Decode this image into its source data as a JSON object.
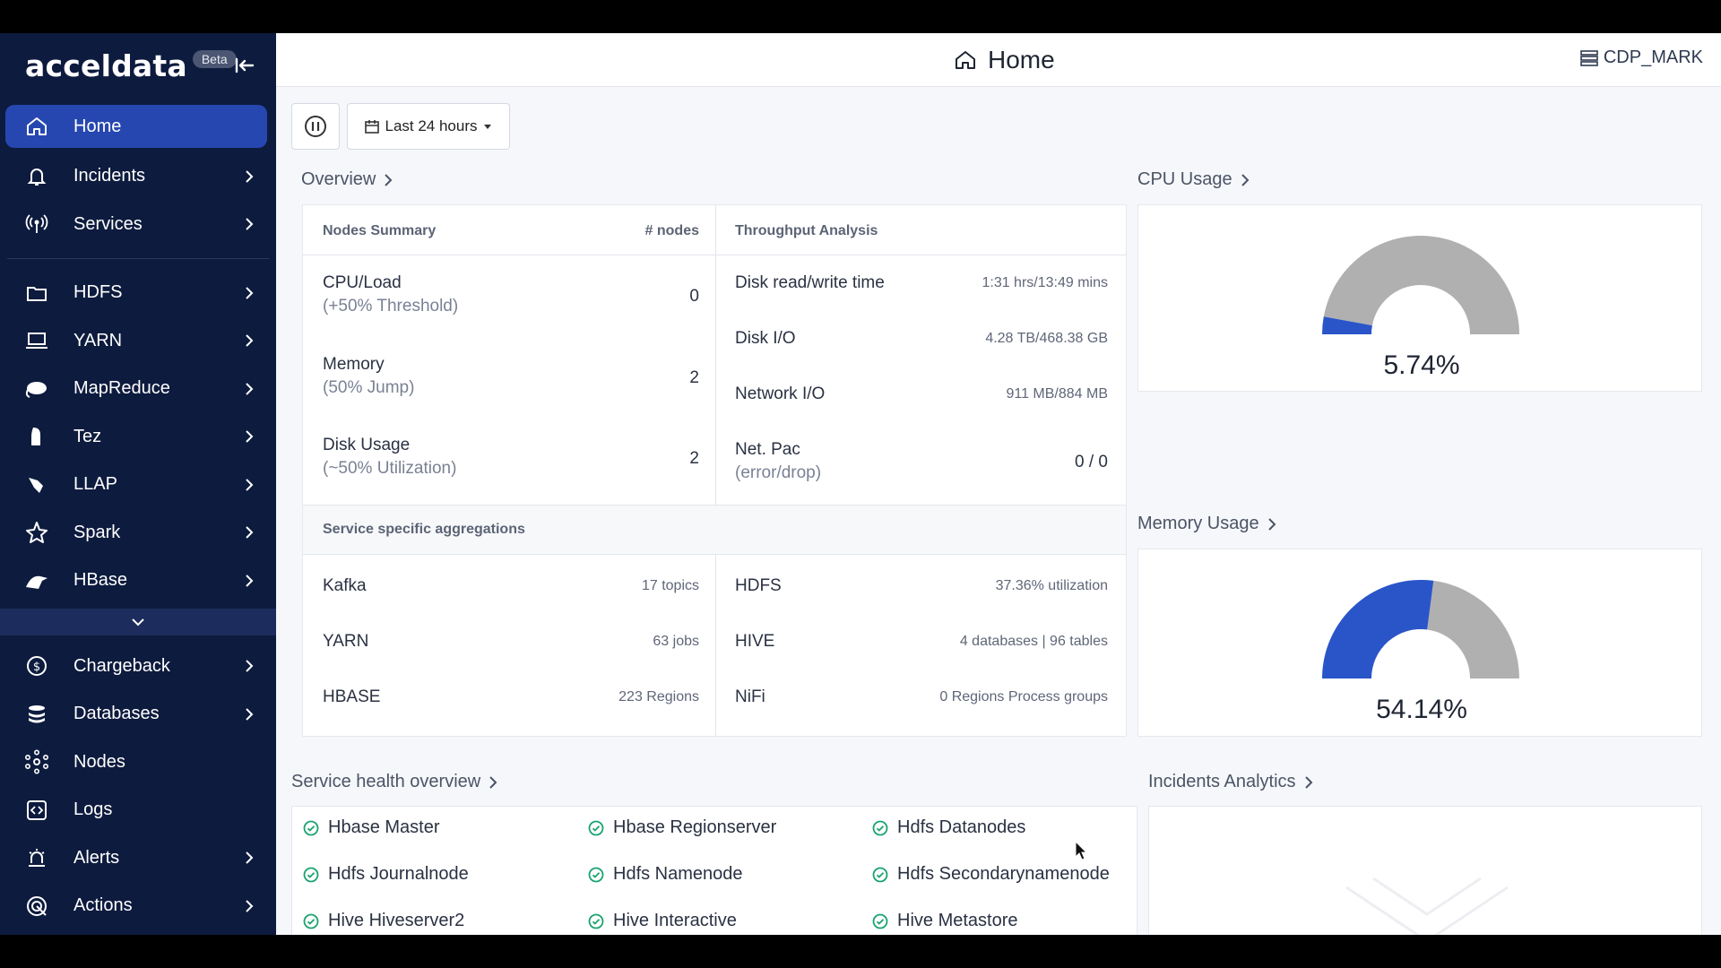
{
  "app": {
    "brand": "acceldata",
    "beta": "Beta"
  },
  "header": {
    "title": "Home",
    "cluster": "CDP_MARK"
  },
  "toolbar": {
    "range_label": "Last 24 hours"
  },
  "sidebar": {
    "items": [
      {
        "label": "Home",
        "icon": "home-icon",
        "active": true
      },
      {
        "label": "Incidents",
        "icon": "bell-icon"
      },
      {
        "label": "Services",
        "icon": "broadcast-icon"
      },
      {
        "label": "HDFS",
        "icon": "folder-icon"
      },
      {
        "label": "YARN",
        "icon": "laptop-icon"
      },
      {
        "label": "MapReduce",
        "icon": "elephant-icon"
      },
      {
        "label": "Tez",
        "icon": "tez-icon"
      },
      {
        "label": "LLAP",
        "icon": "llap-icon"
      },
      {
        "label": "Spark",
        "icon": "spark-icon"
      },
      {
        "label": "HBase",
        "icon": "hbase-icon"
      },
      {
        "label": "Chargeback",
        "icon": "dollar-icon"
      },
      {
        "label": "Databases",
        "icon": "database-icon"
      },
      {
        "label": "Nodes",
        "icon": "nodes-icon"
      },
      {
        "label": "Logs",
        "icon": "logs-icon"
      },
      {
        "label": "Alerts",
        "icon": "alarm-icon"
      },
      {
        "label": "Actions",
        "icon": "actions-icon"
      }
    ]
  },
  "overview": {
    "title": "Overview",
    "nodes_header": "Nodes Summary",
    "nodes_count_header": "# nodes",
    "throughput_header": "Throughput Analysis",
    "nodes": [
      {
        "label": "CPU/Load",
        "sub": "(+50% Threshold)",
        "value": "0"
      },
      {
        "label": "Memory",
        "sub": "(50% Jump)",
        "value": "2"
      },
      {
        "label": "Disk Usage",
        "sub": "(~50% Utilization)",
        "value": "2"
      }
    ],
    "throughput": [
      {
        "label": "Disk read/write time",
        "sub": "",
        "value": "1:31 hrs/13:49 mins"
      },
      {
        "label": "Disk I/O",
        "sub": "",
        "value": "4.28 TB/468.38 GB"
      },
      {
        "label": "Network I/O",
        "sub": "",
        "value": "911 MB/884 MB"
      },
      {
        "label": "Net. Pac",
        "sub": "(error/drop)",
        "value": "0 / 0"
      }
    ],
    "service_header": "Service specific aggregations",
    "services_left": [
      {
        "label": "Kafka",
        "value": "17 topics"
      },
      {
        "label": "YARN",
        "value": "63 jobs"
      },
      {
        "label": "HBASE",
        "value": "223 Regions"
      }
    ],
    "services_right": [
      {
        "label": "HDFS",
        "value": "37.36% utilization"
      },
      {
        "label": "HIVE",
        "value": "4  databases | 96 tables"
      },
      {
        "label": "NiFi",
        "value": "0 Regions Process groups"
      }
    ]
  },
  "cpu": {
    "title": "CPU Usage",
    "value_label": "5.74%",
    "percent": 5.74
  },
  "memory": {
    "title": "Memory Usage",
    "value_label": "54.14%",
    "percent": 54.14
  },
  "health": {
    "title": "Service health overview",
    "items": [
      "Hbase Master",
      "Hbase Regionserver",
      "Hdfs Datanodes",
      "Hdfs Journalnode",
      "Hdfs Namenode",
      "Hdfs Secondarynamenode",
      "Hive Hiveserver2",
      "Hive Interactive",
      "Hive Metastore"
    ]
  },
  "incidents": {
    "title": "Incidents Analytics"
  },
  "colors": {
    "sidebar": "#0d1b3e",
    "active": "#2747b0",
    "gauge_fill": "#2a55c9",
    "gauge_rest": "#b0b0b0",
    "ok": "#1aa36f"
  }
}
